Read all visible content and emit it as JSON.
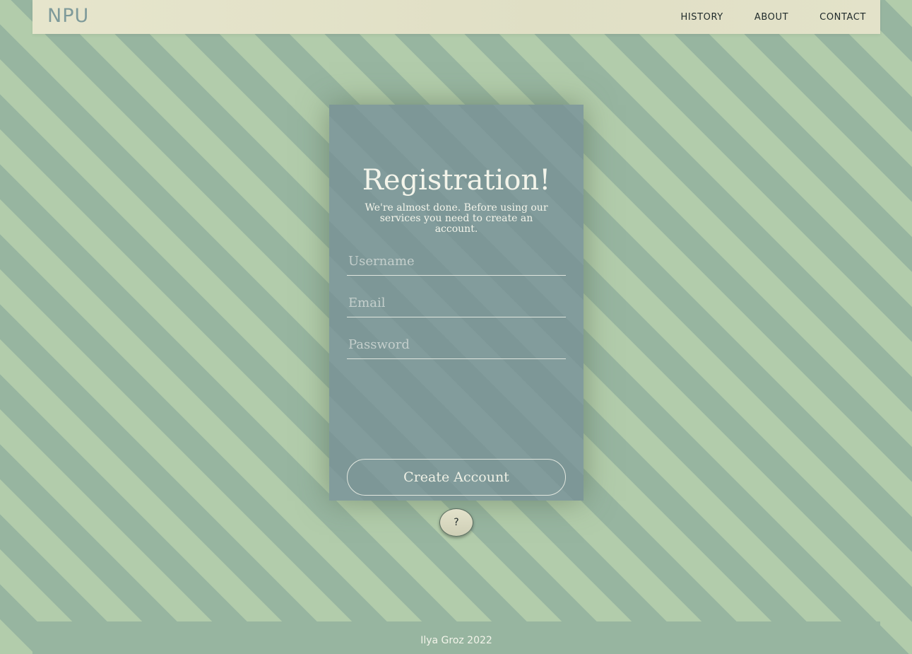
{
  "header": {
    "logo": "NPU",
    "nav": [
      {
        "label": "HISTORY"
      },
      {
        "label": "ABOUT"
      },
      {
        "label": "CONTACT"
      }
    ]
  },
  "registration": {
    "title": "Registration!",
    "subtitle": "We're almost done. Before using our services you need to create an account.",
    "fields": {
      "username": {
        "placeholder": "Username",
        "value": ""
      },
      "email": {
        "placeholder": "Email",
        "value": ""
      },
      "password": {
        "placeholder": "Password",
        "value": ""
      }
    },
    "submit_label": "Create Account"
  },
  "help": {
    "label": "?"
  },
  "footer": {
    "text": "Ilya Groz 2022"
  },
  "colors": {
    "stripe_light": "#b2ccab",
    "stripe_dark": "#97b5a0",
    "navbar_bg": "#e3e2c9",
    "card_bg": "#7f9a9a",
    "logo": "#7e9a9a",
    "text_light": "#f3f4ea"
  }
}
